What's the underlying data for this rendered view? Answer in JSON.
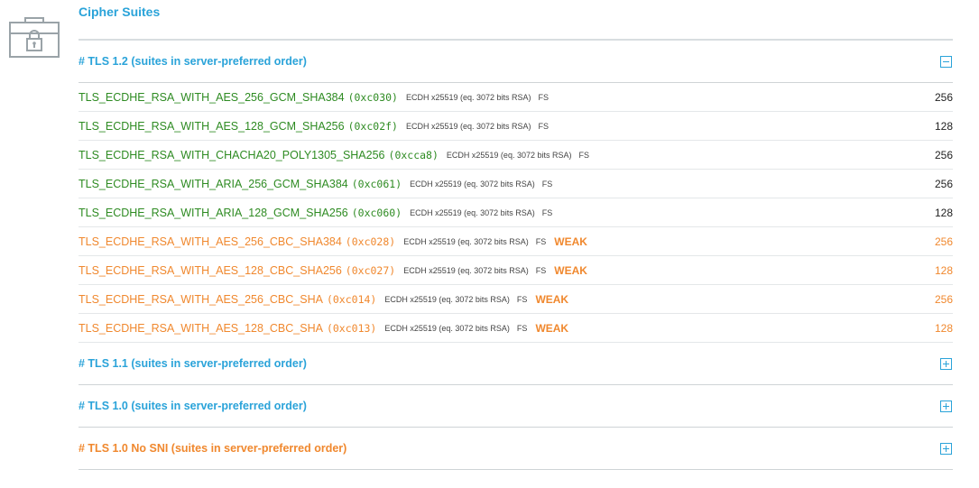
{
  "section": {
    "title": "Cipher Suites"
  },
  "colors": {
    "accent": "#2aa3d9",
    "secure": "#2e8b22",
    "weak": "#f0882e"
  },
  "groups": [
    {
      "title": "# TLS 1.2 (suites in server-preferred order)",
      "expanded": true,
      "toggle_icon": "minus-box-icon"
    },
    {
      "title": "# TLS 1.1 (suites in server-preferred order)",
      "expanded": false,
      "toggle_icon": "plus-box-icon"
    },
    {
      "title": "# TLS 1.0 (suites in server-preferred order)",
      "expanded": false,
      "toggle_icon": "plus-box-icon"
    },
    {
      "title": "# TLS 1.0 No SNI (suites in server-preferred order)",
      "expanded": false,
      "toggle_icon": "plus-box-icon"
    }
  ],
  "suites": [
    {
      "name": "TLS_ECDHE_RSA_WITH_AES_256_GCM_SHA384",
      "code": "(0xc030)",
      "info": "ECDH x25519 (eq. 3072 bits RSA)",
      "fs": "FS",
      "weak": "",
      "bits": "256"
    },
    {
      "name": "TLS_ECDHE_RSA_WITH_AES_128_GCM_SHA256",
      "code": "(0xc02f)",
      "info": "ECDH x25519 (eq. 3072 bits RSA)",
      "fs": "FS",
      "weak": "",
      "bits": "128"
    },
    {
      "name": "TLS_ECDHE_RSA_WITH_CHACHA20_POLY1305_SHA256",
      "code": "(0xcca8)",
      "info": "ECDH x25519 (eq. 3072 bits RSA)",
      "fs": "FS",
      "weak": "",
      "bits": "256"
    },
    {
      "name": "TLS_ECDHE_RSA_WITH_ARIA_256_GCM_SHA384",
      "code": "(0xc061)",
      "info": "ECDH x25519 (eq. 3072 bits RSA)",
      "fs": "FS",
      "weak": "",
      "bits": "256"
    },
    {
      "name": "TLS_ECDHE_RSA_WITH_ARIA_128_GCM_SHA256",
      "code": "(0xc060)",
      "info": "ECDH x25519 (eq. 3072 bits RSA)",
      "fs": "FS",
      "weak": "",
      "bits": "128"
    },
    {
      "name": "TLS_ECDHE_RSA_WITH_AES_256_CBC_SHA384",
      "code": "(0xc028)",
      "info": "ECDH x25519 (eq. 3072 bits RSA)",
      "fs": "FS",
      "weak": "WEAK",
      "bits": "256"
    },
    {
      "name": "TLS_ECDHE_RSA_WITH_AES_128_CBC_SHA256",
      "code": "(0xc027)",
      "info": "ECDH x25519 (eq. 3072 bits RSA)",
      "fs": "FS",
      "weak": "WEAK",
      "bits": "128"
    },
    {
      "name": "TLS_ECDHE_RSA_WITH_AES_256_CBC_SHA",
      "code": "(0xc014)",
      "info": "ECDH x25519 (eq. 3072 bits RSA)",
      "fs": "FS",
      "weak": "WEAK",
      "bits": "256"
    },
    {
      "name": "TLS_ECDHE_RSA_WITH_AES_128_CBC_SHA",
      "code": "(0xc013)",
      "info": "ECDH x25519 (eq. 3072 bits RSA)",
      "fs": "FS",
      "weak": "WEAK",
      "bits": "128"
    }
  ]
}
